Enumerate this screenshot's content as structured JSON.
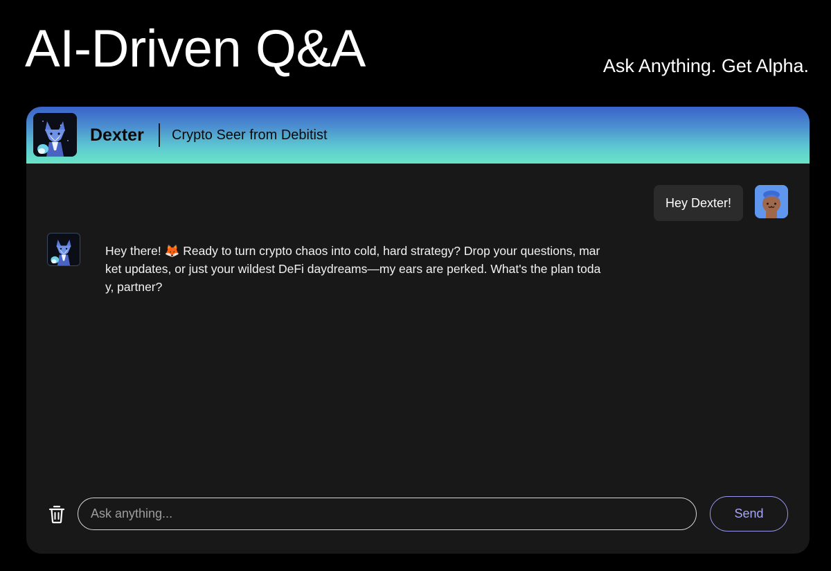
{
  "hero": {
    "title": "AI-Driven Q&A",
    "tagline": "Ask Anything. Get Alpha."
  },
  "chat_header": {
    "bot_name": "Dexter",
    "bot_subtitle": "Crypto Seer from Debitist",
    "bot_avatar_icon": "fox-avatar-icon",
    "gradient_top": "#3a63c9",
    "gradient_bottom": "#6ae5c6"
  },
  "messages": [
    {
      "role": "user",
      "text": "Hey Dexter!",
      "avatar_icon": "user-avatar-icon"
    },
    {
      "role": "bot",
      "text": "Hey there! 🦊 Ready to turn crypto chaos into cold, hard strategy? Drop your questions, market updates, or just your wildest DeFi daydreams—my ears are perked. What's the plan today, partner?",
      "avatar_icon": "fox-avatar-icon"
    }
  ],
  "composer": {
    "placeholder": "Ask anything...",
    "value": "",
    "send_label": "Send",
    "clear_icon": "trash-icon",
    "send_color": "#a7a6f2"
  }
}
